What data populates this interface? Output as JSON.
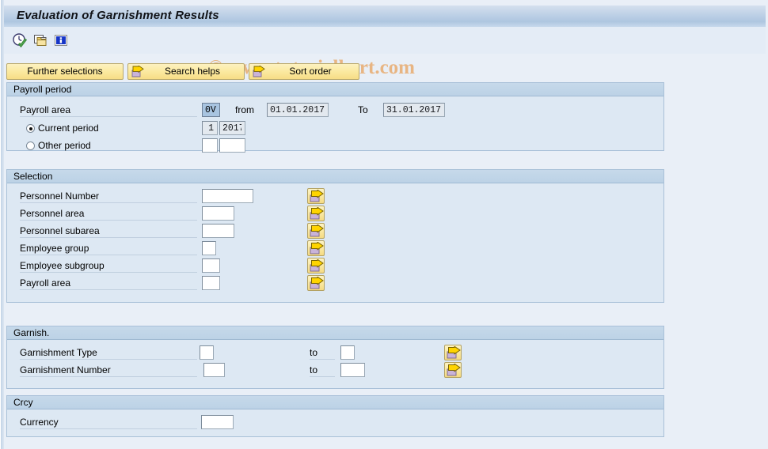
{
  "window": {
    "title": "Evaluation of Garnishment Results"
  },
  "watermark": {
    "text": "© www.tutorialkart.com",
    "color": "#e8b583"
  },
  "toolbar": {
    "icons": [
      {
        "name": "execute-clock-icon",
        "title": "Execute"
      },
      {
        "name": "multiple-selection-icon",
        "title": "Multiple Selection"
      },
      {
        "name": "information-icon",
        "title": "Information"
      }
    ]
  },
  "buttons": {
    "further_selections": "Further selections",
    "search_helps": "Search helps",
    "sort_order": "Sort order"
  },
  "payroll_period": {
    "title": "Payroll period",
    "payroll_area_label": "Payroll area",
    "payroll_area_value": "0V",
    "from_label": "from",
    "from_value": "01.01.2017",
    "to_label": "To",
    "to_value": "31.01.2017",
    "current_period_label": "Current period",
    "current_period_selected": true,
    "current_period_number": "1",
    "current_period_year": "2017",
    "other_period_label": "Other period",
    "other_period_selected": false,
    "other_period_number": "",
    "other_period_year": ""
  },
  "selection": {
    "title": "Selection",
    "rows": [
      {
        "label": "Personnel Number",
        "value": "",
        "input_width": 65,
        "has_arrow": true
      },
      {
        "label": "Personnel area",
        "value": "",
        "input_width": 41,
        "has_arrow": true
      },
      {
        "label": "Personnel subarea",
        "value": "",
        "input_width": 41,
        "has_arrow": true
      },
      {
        "label": "Employee group",
        "value": "",
        "input_width": 18,
        "has_arrow": true
      },
      {
        "label": "Employee subgroup",
        "value": "",
        "input_width": 23,
        "has_arrow": true
      },
      {
        "label": "Payroll area",
        "value": "",
        "input_width": 23,
        "has_arrow": true
      }
    ]
  },
  "garnishment": {
    "title": "Garnish.",
    "to_label": "to",
    "rows": [
      {
        "label": "Garnishment Type",
        "from_value": "",
        "to_value": "",
        "from_width": 18,
        "to_width": 18,
        "has_arrow": true
      },
      {
        "label": "Garnishment Number",
        "from_value": "",
        "to_value": "",
        "from_width": 27,
        "to_width": 31,
        "has_arrow": true
      }
    ]
  },
  "currency": {
    "title": "Crcy",
    "label": "Currency",
    "value": ""
  },
  "colors": {
    "page_background": "#e9eff7",
    "group_background": "#dde8f3",
    "group_header": "#c6d9ea",
    "button_yellow": "#fbe9a0",
    "title_bar": "#bdd0e6",
    "arrow_yellow": "#ffd400",
    "folder_purple": "#c9b3d9"
  }
}
